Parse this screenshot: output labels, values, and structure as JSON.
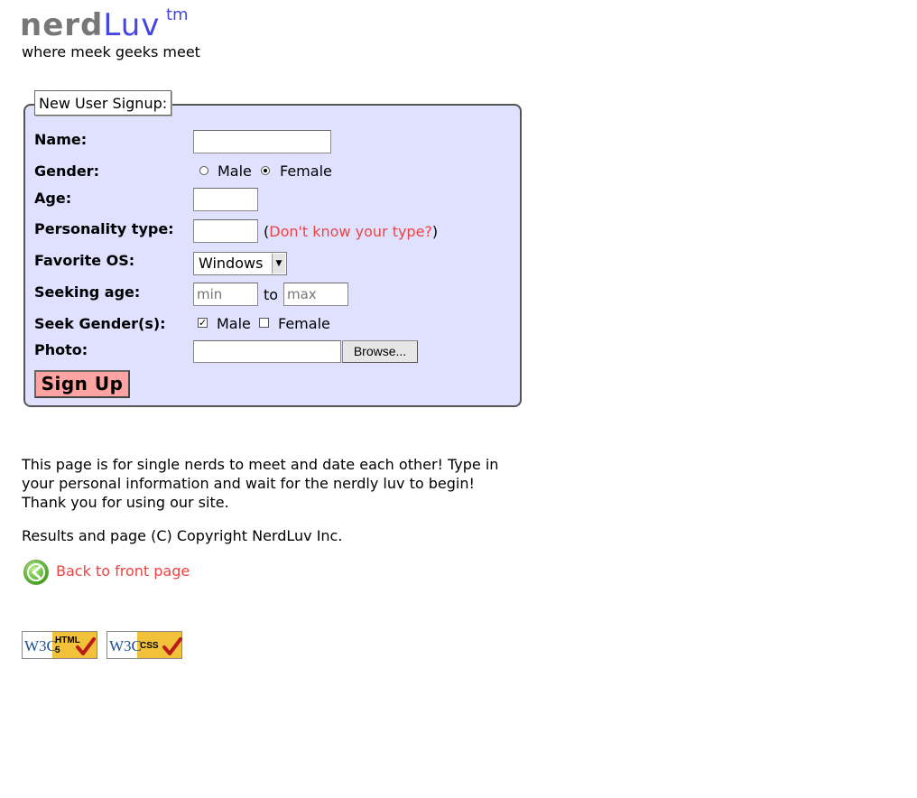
{
  "header": {
    "logo_nerd": "nerd",
    "logo_luv": "Luv",
    "logo_tm": "tm",
    "tagline": "where meek geeks meet"
  },
  "form": {
    "legend": "New User Signup:",
    "name_label": "Name:",
    "name_value": "",
    "gender_label": "Gender:",
    "gender_options": [
      "Male",
      "Female"
    ],
    "gender_selected": "Female",
    "age_label": "Age:",
    "age_value": "",
    "personality_label": "Personality type:",
    "personality_value": "",
    "personality_help_open": "(",
    "personality_help_link": "Don't know your type?",
    "personality_help_close": ")",
    "os_label": "Favorite OS:",
    "os_selected": "Windows",
    "seeking_label": "Seeking age:",
    "seeking_min_placeholder": "min",
    "seeking_to": "to",
    "seeking_max_placeholder": "max",
    "seek_gender_label": "Seek Gender(s):",
    "seek_gender_options": [
      "Male",
      "Female"
    ],
    "seek_gender_checked": [
      "Male"
    ],
    "photo_label": "Photo:",
    "browse_label": "Browse...",
    "submit_label": "Sign Up"
  },
  "intro": "This page is for single nerds to meet and date each other! Type in your personal information and wait for the nerdly luv to begin! Thank you for using our site.",
  "copyright": "Results and page (C) Copyright NerdLuv Inc.",
  "back_link": "Back to front page",
  "badges": {
    "html": {
      "w3c": "W3C",
      "line1": "HTML",
      "line2": "5"
    },
    "css": {
      "w3c": "W3C",
      "line1": "CSS"
    }
  },
  "colors": {
    "accent_blue": "#4646e6",
    "link_red": "#ea4545",
    "fieldset_bg": "#e0e0ff",
    "button_pink": "#ffa3a3",
    "badge_gold": "#f2c13a"
  }
}
